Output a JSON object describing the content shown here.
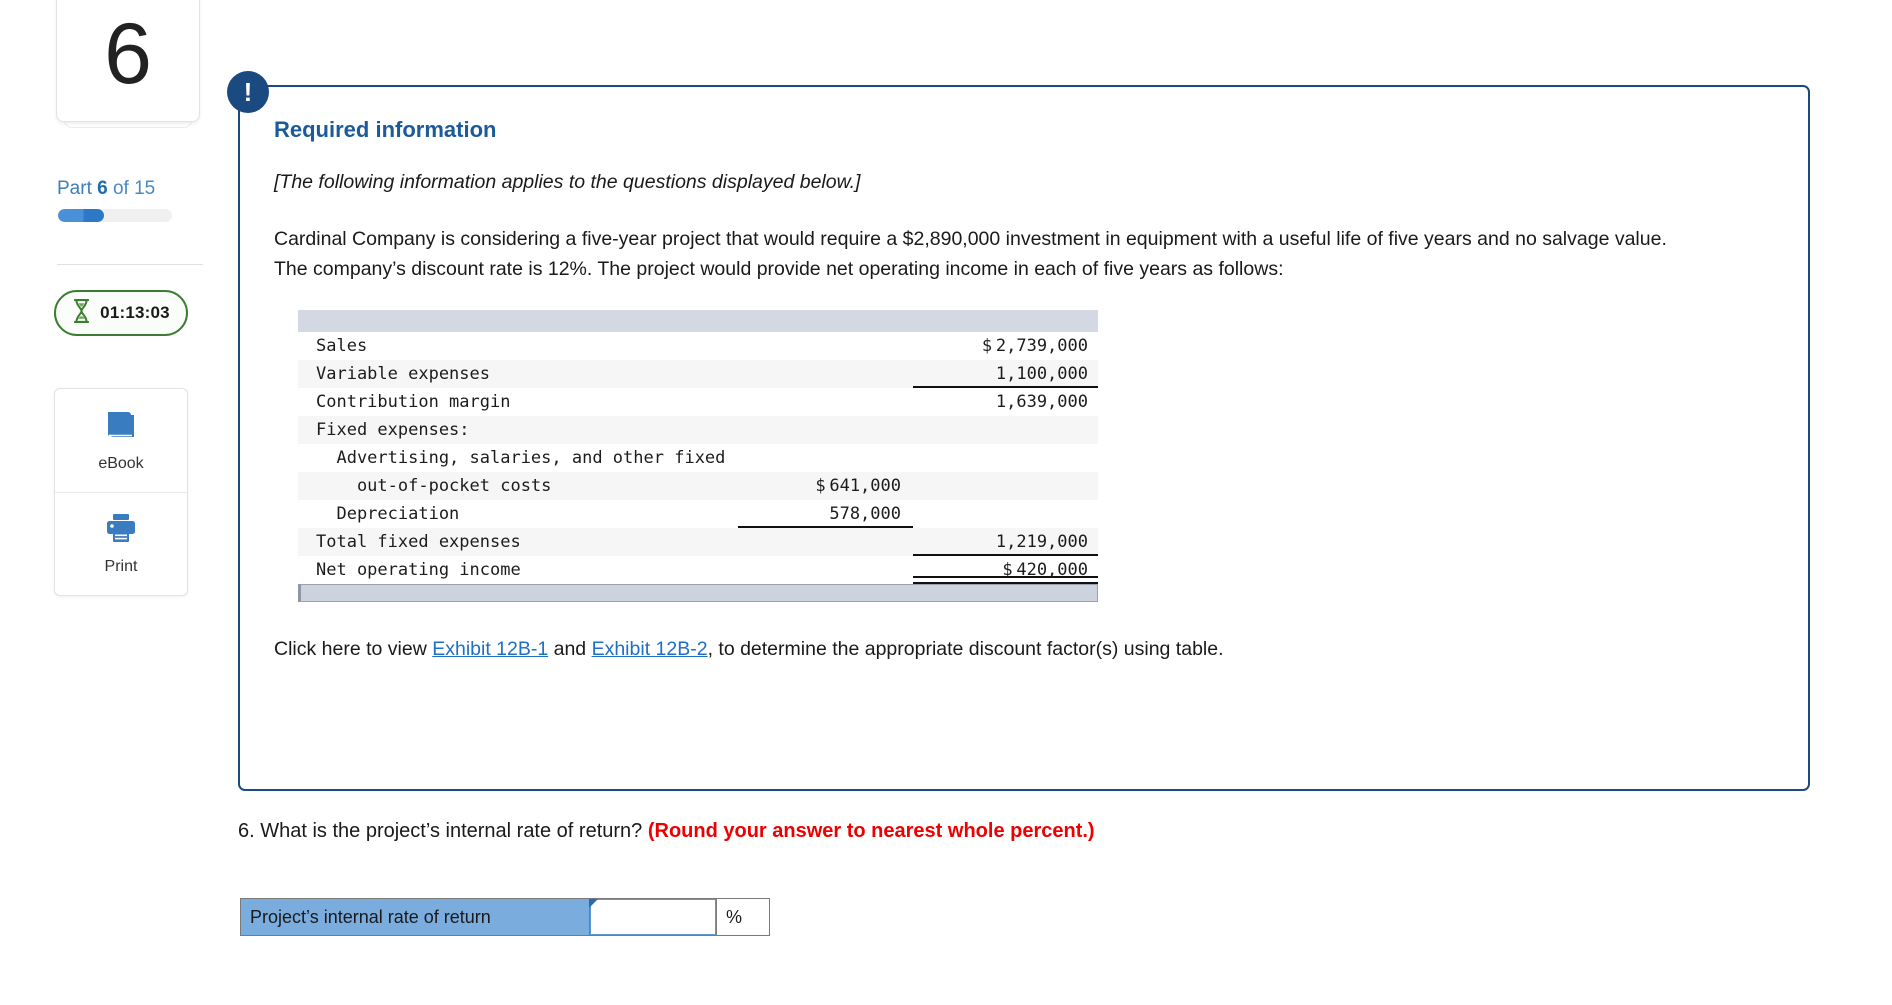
{
  "sidebar": {
    "part_number": "6",
    "part_label_prefix": "Part ",
    "part_label_bold": "6",
    "part_label_suffix": " of 15",
    "progress_percent": 40,
    "timer": "01:13:03",
    "tools": [
      {
        "icon": "book-icon",
        "label": "eBook"
      },
      {
        "icon": "printer-icon",
        "label": "Print"
      }
    ]
  },
  "card": {
    "badge": "!",
    "title": "Required information",
    "italic_note": "[The following information applies to the questions displayed below.]",
    "paragraph": "Cardinal Company is considering a five-year project that would require a $2,890,000 investment in equipment with a useful life of five years and no salvage value. The company’s discount rate is 12%. The project would provide net operating income in each of five years as follows:",
    "exhibit": {
      "prefix": "Click here to view ",
      "link1": "Exhibit 12B-1",
      "middle": " and ",
      "link2": "Exhibit 12B-2",
      "suffix": ", to determine the appropriate discount factor(s) using table."
    }
  },
  "financials": {
    "rows": [
      {
        "label": "Sales",
        "mid": "",
        "mid_symbol": "",
        "right": "2,739,000",
        "right_symbol": "$",
        "right_rule": "none",
        "mid_rule": "none"
      },
      {
        "label": "Variable expenses",
        "mid": "",
        "mid_symbol": "",
        "right": "1,100,000",
        "right_symbol": "",
        "right_rule": "single",
        "mid_rule": "none"
      },
      {
        "label": "Contribution margin",
        "mid": "",
        "mid_symbol": "",
        "right": "1,639,000",
        "right_symbol": "",
        "right_rule": "none",
        "mid_rule": "none"
      },
      {
        "label": "Fixed expenses:",
        "mid": "",
        "mid_symbol": "",
        "right": "",
        "right_symbol": "",
        "right_rule": "none",
        "mid_rule": "none"
      },
      {
        "label": "  Advertising, salaries, and other fixed",
        "mid": "",
        "mid_symbol": "",
        "right": "",
        "right_symbol": "",
        "right_rule": "none",
        "mid_rule": "none"
      },
      {
        "label": "    out-of-pocket costs",
        "mid": "641,000",
        "mid_symbol": "$",
        "right": "",
        "right_symbol": "",
        "right_rule": "none",
        "mid_rule": "none"
      },
      {
        "label": "  Depreciation",
        "mid": "578,000",
        "mid_symbol": "",
        "right": "",
        "right_symbol": "",
        "right_rule": "none",
        "mid_rule": "single"
      },
      {
        "label": "Total fixed expenses",
        "mid": "",
        "mid_symbol": "",
        "right": "1,219,000",
        "right_symbol": "",
        "right_rule": "single",
        "mid_rule": "none"
      },
      {
        "label": "Net operating income",
        "mid": "",
        "mid_symbol": "",
        "right": "420,000",
        "right_symbol": "$",
        "right_rule": "double",
        "mid_rule": "none"
      }
    ]
  },
  "question": {
    "number_and_text": "6. What is the project’s internal rate of return? ",
    "warning": "(Round your answer to nearest whole percent.)"
  },
  "answer": {
    "label": "Project’s internal rate of return",
    "value": "",
    "placeholder": "",
    "unit": "%"
  },
  "colors": {
    "brand_blue": "#1b4a80",
    "title_blue": "#1b5b99",
    "link_blue": "#1f6fc4",
    "warning_red": "#ee0000",
    "answer_label_blue": "#7bacde",
    "timer_green": "#3c7d33",
    "table_header_gray": "#d3d8e3"
  }
}
